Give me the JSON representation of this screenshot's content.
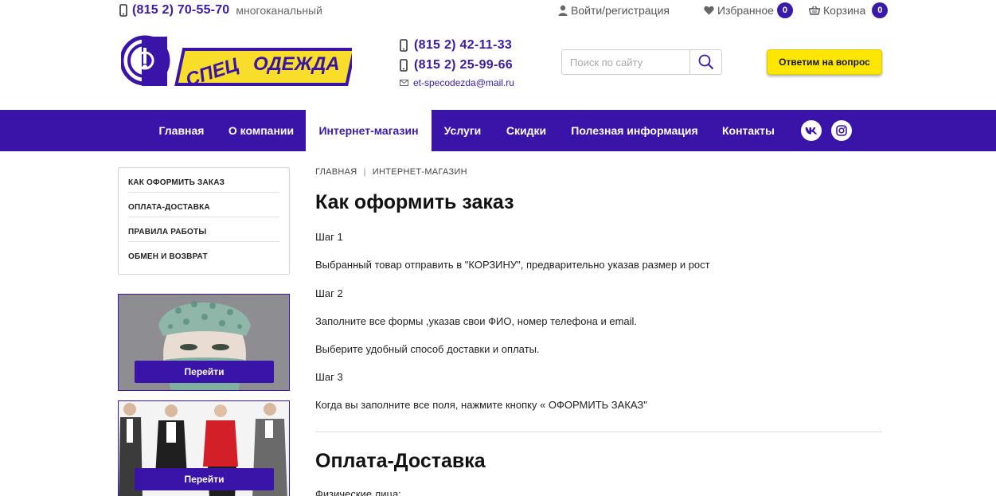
{
  "topbar": {
    "phone": "(815 2) 70-55-70",
    "phone_note": "многоканальный",
    "login": "Войти/регистрация",
    "favorites": "Избранное",
    "favorites_count": "0",
    "cart": "Корзина",
    "cart_count": "0"
  },
  "logo": {
    "text_line1": "СПЕЦ",
    "text_line2": "ОДЕЖДА"
  },
  "contacts": {
    "phone1": "(815 2) 42-11-33",
    "phone2": "(815 2) 25-99-66",
    "email": "et-specodezda@mail.ru"
  },
  "search": {
    "placeholder": "Поиск по сайту"
  },
  "ask_button": "Ответим на вопрос",
  "nav": {
    "items": [
      {
        "label": "Главная"
      },
      {
        "label": "О компании"
      },
      {
        "label": "Интернет-магазин"
      },
      {
        "label": "Услуги"
      },
      {
        "label": "Скидки"
      },
      {
        "label": "Полезная информация"
      },
      {
        "label": "Контакты"
      }
    ],
    "active": "Интернет-магазин"
  },
  "sidebar": {
    "items": [
      {
        "label": "КАК ОФОРМИТЬ ЗАКАЗ"
      },
      {
        "label": "ОПЛАТА-ДОСТАВКА"
      },
      {
        "label": "ПРАВИЛА РАБОТЫ"
      },
      {
        "label": "ОБМЕН И ВОЗВРАТ"
      }
    ],
    "promos": [
      {
        "button": "Перейти"
      },
      {
        "button": "Перейти"
      }
    ]
  },
  "breadcrumb": [
    "ГЛАВНАЯ",
    "ИНТЕРНЕТ-МАГАЗИН"
  ],
  "main": {
    "title": "Как оформить заказ",
    "paragraphs": [
      "Шаг 1",
      "Выбранный товар отправить в \"КОРЗИНУ\", предварительно указав размер и рост",
      "Шаг 2",
      "Заполните все формы ,указав свои ФИО, номер телефона и email.",
      "Выберите удобный способ доставки и оплаты.",
      "Шаг 3",
      "Когда вы заполните все поля, нажмите кнопку « ОФОРМИТЬ ЗАКАЗ\""
    ],
    "section2_title": "Оплата-Доставка",
    "section2_first_line": "Физические лица:"
  },
  "colors": {
    "brand_purple": "#3a14a8",
    "accent_yellow": "#fde600"
  }
}
